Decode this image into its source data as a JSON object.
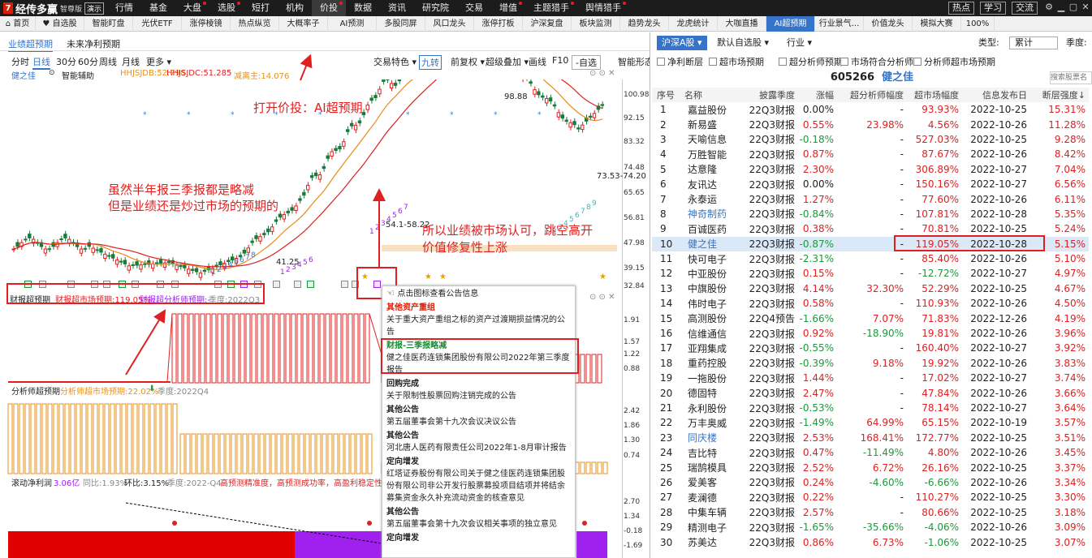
{
  "app": {
    "logo": "经传多赢",
    "edition": "智尊版",
    "demo": "演示",
    "menu": [
      "行情",
      "基金",
      "大盘",
      "选股",
      "短打",
      "机构",
      "价投",
      "数据",
      "资讯",
      "研究院",
      "交易",
      "增值",
      "主题猎手",
      "舆情猎手"
    ],
    "right_buttons": [
      "热点",
      "学习",
      "交流"
    ]
  },
  "tabs": [
    "首页",
    "自选股",
    "智能盯盘",
    "光伏ETF",
    "涨停棱镜",
    "热点纵览",
    "大概率子",
    "AI预测",
    "多股同屏",
    "风口龙头",
    "涨停打板",
    "沪深复盘",
    "板块监测",
    "趋势龙头",
    "龙虎统计",
    "大咖直播",
    "AI超预期",
    "行业景气...",
    "价值龙头",
    "模拟大赛",
    "100%"
  ],
  "left": {
    "subtabs": [
      "业绩超预期",
      "未来净利预期"
    ],
    "periods": [
      "分时",
      "日线",
      "30分",
      "60分",
      "周线",
      "月线",
      "更多 ▾"
    ],
    "tools": [
      "交易特色 ▾",
      "九转",
      "前复权 ▾",
      "超级叠加 ▾",
      "画线",
      "F10",
      "-自选",
      "智能形态"
    ],
    "indicator": {
      "name": "健之佳",
      "assist": "智能辅助",
      "a": "HHJSJDB:52.798",
      "b": "HHJSJDC:51.285",
      "c": "减离主:14.076"
    },
    "price_labels": [
      "100.98",
      "92.15",
      "83.32",
      "74.48",
      "65.65",
      "56.81",
      "47.98",
      "39.15",
      "32.84"
    ],
    "chart_values": [
      "98.88",
      "73.53-74.20",
      "41.25",
      "54.1-58.22"
    ],
    "fin_labels": {
      "a": "财报超预期",
      "b": "财报超市场预期:119.05%",
      "c": "财报超分析师预期:-",
      "d": "季度:2022Q3"
    },
    "fin_prices": [
      "1.91",
      "1.57",
      "1.22",
      "0.88"
    ],
    "ana_labels": {
      "a": "分析师超预期",
      "b": "分析师超市场预期:22.02%",
      "c": "季度:2022Q4"
    },
    "ana_prices": [
      "2.42",
      "1.86",
      "1.30",
      "0.74"
    ],
    "roll_labels": {
      "a": "滚动净利润",
      "b": "3.06亿",
      "c": "同比:1.93%",
      "d": "环比:3.15%",
      "e": "季度:2022-Q4",
      "f": "高预测精准度，高预测成功率，高盈利稳定性"
    },
    "roll_prices": [
      "2.70",
      "1.34",
      "-0.18",
      "-1.69"
    ],
    "annotations": {
      "a1": "打开价投：AI超预期",
      "a2": "虽然半年报三季报都是略减",
      "a3": "但是业绩还是炒过市场的预期的",
      "a4": "所以业绩被市场认可，跳空高开",
      "a5": "价值修复性上涨"
    },
    "popup": [
      {
        "t": "h0",
        "h": "点击图标查看公告信息"
      },
      {
        "t": "r",
        "h": "其他资产重组",
        "b": "关于重大资产重组之标的资产过渡期损益情况的公告"
      },
      {
        "t": "g",
        "h": "财报-三季报略减",
        "b": "健之佳医药连锁集团股份有限公司2022年第三季度报告"
      },
      {
        "t": "k",
        "h": "回购完成",
        "b": "关于限制性股票回购注销完成的公告"
      },
      {
        "t": "k",
        "h": "其他公告",
        "b": "第五届董事会第十九次会议决议公告"
      },
      {
        "t": "k",
        "h": "其他公告",
        "b": "河北唐人医药有限责任公司2022年1-8月审计报告"
      },
      {
        "t": "k",
        "h": "定向增发",
        "b": "红塔证券股份有限公司关于健之佳医药连锁集团股份有限公司非公开发行股票募投项目结项并将结余募集资金永久补充流动资金的核查意见"
      },
      {
        "t": "k",
        "h": "其他公告",
        "b": "第五届董事会第十九次会议相关事项的独立意见"
      },
      {
        "t": "k",
        "h": "定向增发",
        "b": ""
      }
    ]
  },
  "right": {
    "tabs": [
      "沪深A股 ▾",
      "默认自选股 ▾",
      "行业 ▾"
    ],
    "type_label": "类型:",
    "type_value": "累计",
    "season_label": "季度:",
    "checks": [
      "净利断层",
      "超市场预期",
      "超分析师预期",
      "市场符合分析师",
      "分析师超市场预期"
    ],
    "stock_code": "605266",
    "stock_name": "健之佳",
    "search_placeholder": "搜索股票名",
    "headers": [
      "序号",
      "名称",
      "披露季度",
      "涨幅",
      "超分析师幅度",
      "超市场幅度",
      "信息发布日",
      "断层强度↓"
    ],
    "rows": [
      [
        "1",
        "嘉益股份",
        "22Q3财报",
        "0.00%",
        "-",
        "93.93%",
        "2022-10-25",
        "15.31%"
      ],
      [
        "2",
        "新易盛",
        "22Q3财报",
        "0.55%",
        "23.98%",
        "4.56%",
        "2022-10-26",
        "11.28%"
      ],
      [
        "3",
        "天喻信息",
        "22Q3财报",
        "-0.18%",
        "-",
        "527.03%",
        "2022-10-25",
        "9.28%"
      ],
      [
        "4",
        "万胜智能",
        "22Q3财报",
        "0.87%",
        "-",
        "87.67%",
        "2022-10-26",
        "8.42%"
      ],
      [
        "5",
        "达意隆",
        "22Q3财报",
        "2.30%",
        "-",
        "306.89%",
        "2022-10-27",
        "7.04%"
      ],
      [
        "6",
        "友讯达",
        "22Q3财报",
        "0.00%",
        "-",
        "150.16%",
        "2022-10-27",
        "6.56%"
      ],
      [
        "7",
        "永泰运",
        "22Q3财报",
        "1.27%",
        "-",
        "77.60%",
        "2022-10-26",
        "6.11%"
      ],
      [
        "8",
        "神奇制药",
        "22Q3财报",
        "-0.84%",
        "-",
        "107.81%",
        "2022-10-28",
        "5.35%"
      ],
      [
        "9",
        "百诚医药",
        "22Q3财报",
        "0.38%",
        "-",
        "70.81%",
        "2022-10-25",
        "5.24%"
      ],
      [
        "10",
        "健之佳",
        "22Q3财报",
        "-0.87%",
        "-",
        "119.05%",
        "2022-10-28",
        "5.15%"
      ],
      [
        "11",
        "快可电子",
        "22Q3财报",
        "-2.31%",
        "-",
        "85.40%",
        "2022-10-26",
        "5.10%"
      ],
      [
        "12",
        "中亚股份",
        "22Q3财报",
        "0.15%",
        "-",
        "-12.72%",
        "2022-10-27",
        "4.97%"
      ],
      [
        "13",
        "中旗股份",
        "22Q3财报",
        "4.14%",
        "32.30%",
        "52.29%",
        "2022-10-25",
        "4.67%"
      ],
      [
        "14",
        "伟时电子",
        "22Q3财报",
        "0.58%",
        "-",
        "110.93%",
        "2022-10-26",
        "4.50%"
      ],
      [
        "15",
        "高测股份",
        "22Q4预告",
        "-1.66%",
        "7.07%",
        "71.83%",
        "2022-12-26",
        "4.19%"
      ],
      [
        "16",
        "信维通信",
        "22Q3财报",
        "0.92%",
        "-18.90%",
        "19.81%",
        "2022-10-26",
        "3.96%"
      ],
      [
        "17",
        "亚翔集成",
        "22Q3财报",
        "-0.55%",
        "-",
        "160.40%",
        "2022-10-27",
        "3.92%"
      ],
      [
        "18",
        "重药控股",
        "22Q3财报",
        "-0.39%",
        "9.18%",
        "19.92%",
        "2022-10-26",
        "3.83%"
      ],
      [
        "19",
        "一拖股份",
        "22Q3财报",
        "1.44%",
        "-",
        "17.02%",
        "2022-10-27",
        "3.74%"
      ],
      [
        "20",
        "德固特",
        "22Q3财报",
        "2.47%",
        "-",
        "47.84%",
        "2022-10-26",
        "3.66%"
      ],
      [
        "21",
        "永利股份",
        "22Q3财报",
        "-0.53%",
        "-",
        "78.14%",
        "2022-10-27",
        "3.64%"
      ],
      [
        "22",
        "万丰奥威",
        "22Q3财报",
        "-1.49%",
        "64.99%",
        "65.15%",
        "2022-10-19",
        "3.57%"
      ],
      [
        "23",
        "同庆楼",
        "22Q3财报",
        "2.53%",
        "168.41%",
        "172.77%",
        "2022-10-25",
        "3.51%"
      ],
      [
        "24",
        "吉比特",
        "22Q3财报",
        "0.47%",
        "-11.49%",
        "4.80%",
        "2022-10-26",
        "3.45%"
      ],
      [
        "25",
        "瑞鹄模具",
        "22Q3财报",
        "2.52%",
        "6.72%",
        "26.16%",
        "2022-10-25",
        "3.37%"
      ],
      [
        "26",
        "爱美客",
        "22Q3财报",
        "0.24%",
        "-4.60%",
        "-6.66%",
        "2022-10-26",
        "3.34%"
      ],
      [
        "27",
        "麦澜德",
        "22Q3财报",
        "0.22%",
        "-",
        "110.27%",
        "2022-10-25",
        "3.30%"
      ],
      [
        "28",
        "中集车辆",
        "22Q3财报",
        "2.57%",
        "-",
        "80.66%",
        "2022-10-25",
        "3.18%"
      ],
      [
        "29",
        "精测电子",
        "22Q3财报",
        "-1.65%",
        "-35.66%",
        "-4.06%",
        "2022-10-26",
        "3.09%"
      ],
      [
        "30",
        "苏美达",
        "22Q3财报",
        "0.86%",
        "6.73%",
        "-1.06%",
        "2022-10-25",
        "3.07%"
      ]
    ],
    "edge_values": [
      "8",
      "8",
      "8",
      "8",
      "8",
      "8",
      "8",
      "8",
      "8"
    ]
  },
  "colors": {
    "accent": "#3574c8",
    "up": "#e02020",
    "down": "#1a9a3a",
    "purple": "#a020f0",
    "orange": "#e8901a"
  }
}
